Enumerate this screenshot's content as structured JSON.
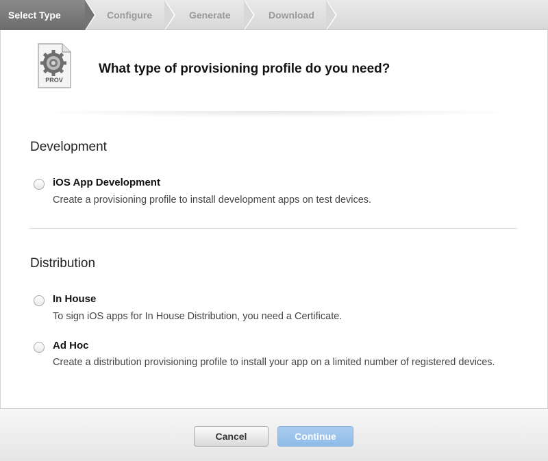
{
  "steps": [
    {
      "label": "Select Type"
    },
    {
      "label": "Configure"
    },
    {
      "label": "Generate"
    },
    {
      "label": "Download"
    }
  ],
  "header": {
    "icon_label": "PROV",
    "title": "What type of provisioning profile do you need?"
  },
  "sections": {
    "development": {
      "title": "Development",
      "options": [
        {
          "title": "iOS App Development",
          "description": "Create a provisioning profile to install development apps on test devices."
        }
      ]
    },
    "distribution": {
      "title": "Distribution",
      "options": [
        {
          "title": "In House",
          "description": "To sign iOS apps for In House Distribution, you need a Certificate."
        },
        {
          "title": "Ad Hoc",
          "description": "Create a distribution provisioning profile to install your app on a limited number of registered devices."
        }
      ]
    }
  },
  "footer": {
    "cancel_label": "Cancel",
    "continue_label": "Continue"
  },
  "colors": {
    "active_step": "#7a7a7a",
    "continue_button": "#9bc4ec"
  }
}
